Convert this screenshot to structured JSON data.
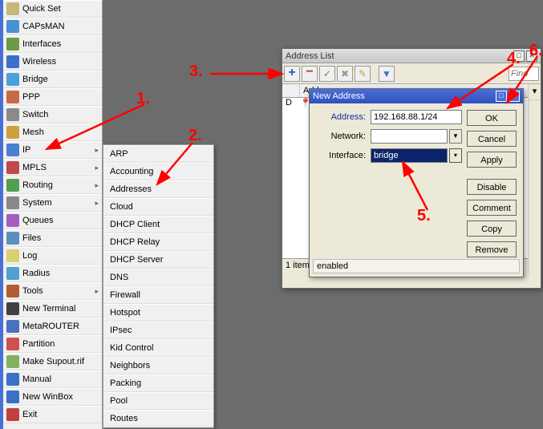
{
  "sidebar": {
    "items": [
      {
        "label": "Quick Set",
        "icon": "#c8b878",
        "arrow": false
      },
      {
        "label": "CAPsMAN",
        "icon": "#4a90d4",
        "arrow": false
      },
      {
        "label": "Interfaces",
        "icon": "#6a9a4a",
        "arrow": false
      },
      {
        "label": "Wireless",
        "icon": "#3a70c8",
        "arrow": false
      },
      {
        "label": "Bridge",
        "icon": "#4aa0d8",
        "arrow": false
      },
      {
        "label": "PPP",
        "icon": "#c86a4a",
        "arrow": false
      },
      {
        "label": "Switch",
        "icon": "#8a8a8a",
        "arrow": false
      },
      {
        "label": "Mesh",
        "icon": "#d0a040",
        "arrow": false
      },
      {
        "label": "IP",
        "icon": "#4a80d0",
        "arrow": true
      },
      {
        "label": "MPLS",
        "icon": "#c04a4a",
        "arrow": true
      },
      {
        "label": "Routing",
        "icon": "#50a050",
        "arrow": true
      },
      {
        "label": "System",
        "icon": "#888888",
        "arrow": true
      },
      {
        "label": "Queues",
        "icon": "#a060c0",
        "arrow": false
      },
      {
        "label": "Files",
        "icon": "#5a90c0",
        "arrow": false
      },
      {
        "label": "Log",
        "icon": "#d8d070",
        "arrow": false
      },
      {
        "label": "Radius",
        "icon": "#50a0d0",
        "arrow": false
      },
      {
        "label": "Tools",
        "icon": "#b06030",
        "arrow": true
      },
      {
        "label": "New Terminal",
        "icon": "#404040",
        "arrow": false
      },
      {
        "label": "MetaROUTER",
        "icon": "#4a70c0",
        "arrow": false
      },
      {
        "label": "Partition",
        "icon": "#d05050",
        "arrow": false
      },
      {
        "label": "Make Supout.rif",
        "icon": "#80b060",
        "arrow": false
      },
      {
        "label": "Manual",
        "icon": "#3a70c8",
        "arrow": false
      },
      {
        "label": "New WinBox",
        "icon": "#3a70c8",
        "arrow": false
      },
      {
        "label": "Exit",
        "icon": "#c04040",
        "arrow": false
      }
    ]
  },
  "submenu": {
    "items": [
      "ARP",
      "Accounting",
      "Addresses",
      "Cloud",
      "DHCP Client",
      "DHCP Relay",
      "DHCP Server",
      "DNS",
      "Firewall",
      "Hotspot",
      "IPsec",
      "Kid Control",
      "Neighbors",
      "Packing",
      "Pool",
      "Routes"
    ]
  },
  "addr_window": {
    "title": "Address List",
    "find_placeholder": "Find",
    "col_address": "Address",
    "row_flag": "D",
    "status": "1 item",
    "dd_arrow": "▾"
  },
  "new_addr": {
    "title": "New Address",
    "lbl_address": "Address:",
    "lbl_network": "Network:",
    "lbl_interface": "Interface:",
    "val_address": "192.168.88.1/24",
    "val_network": "",
    "val_interface": "bridge",
    "status_enabled": "enabled",
    "buttons": {
      "ok": "OK",
      "cancel": "Cancel",
      "apply": "Apply",
      "disable": "Disable",
      "comment": "Comment",
      "copy": "Copy",
      "remove": "Remove"
    }
  },
  "annotations": {
    "a1": "1.",
    "a2": "2.",
    "a3": "3.",
    "a4": "4.",
    "a5": "5.",
    "a6": "6."
  }
}
